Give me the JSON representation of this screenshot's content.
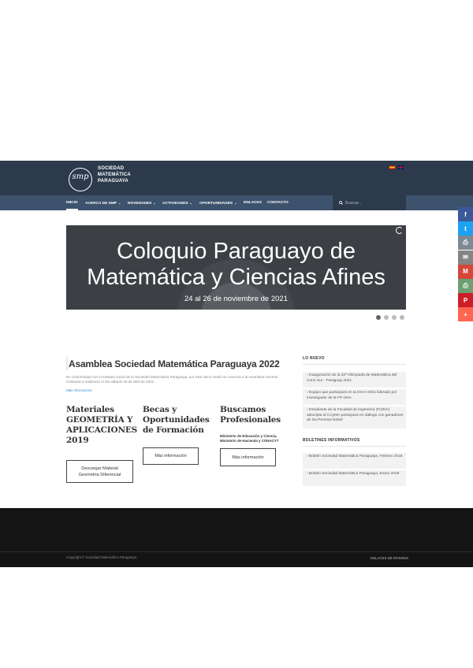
{
  "header": {
    "logo_glyph": "smp",
    "logo_lines": [
      "SOCIEDAD",
      "MATEMÁTICA",
      "PARAGUAYA"
    ]
  },
  "nav": {
    "items": [
      {
        "label": "INICIO"
      },
      {
        "label": "ACERCA DE SMP"
      },
      {
        "label": "NOVEDADES"
      },
      {
        "label": "ACTIVIDADES"
      },
      {
        "label": "OPORTUNIDADES"
      },
      {
        "label": "ENLACES"
      },
      {
        "label": "CONTACTO"
      }
    ],
    "search_placeholder": "Buscar..."
  },
  "slider": {
    "title_line1": "Coloquio Paraguayo de",
    "title_line2": "Matemática y Ciencias Afines",
    "subtitle": "24 al 26 de noviembre de 2021",
    "slide_count": 4,
    "active_slide": 1
  },
  "share": {
    "icons": [
      "facebook-icon",
      "twitter-icon",
      "print-icon",
      "email-icon",
      "gmail-icon",
      "printfriendly-icon",
      "pinterest-icon",
      "more-icon"
    ],
    "glyphs": [
      "f",
      "t",
      "⎙",
      "✉",
      "M",
      "⎙",
      "P",
      "+"
    ],
    "colors": [
      "#3b5998",
      "#1da1f2",
      "#7d8a94",
      "#848484",
      "#d44638",
      "#6d9f71",
      "#cb2027",
      "#ff6550"
    ]
  },
  "main": {
    "title": "Asamblea Sociedad Matemática Paraguaya 2022",
    "text": "En conformidad con el estatuto social de la Sociedad Matemática Paraguaya, por este único medio se convoca a la Asamblea General Ordinaria a realizarse el día sábado 30 de abril de 2022.",
    "more_link": "Más información",
    "columns": [
      {
        "title_lines": [
          "Materiales",
          "GEOMETRÍA Y",
          "APLICACIONES",
          "2019"
        ],
        "button_lines": [
          "Descargar Material",
          "Geometría Diferencial"
        ]
      },
      {
        "title_lines": [
          "Becas y",
          "Oportunidades",
          "de Formación"
        ],
        "button_lines": [
          "Más información"
        ]
      },
      {
        "title_lines": [
          "Buscamos",
          "Profesionales"
        ],
        "sub_lines": [
          "Ministerio de Educación y Ciencia,",
          "Ministerio de Hacienda y CONACYT"
        ],
        "button_lines": [
          "Más información"
        ]
      }
    ]
  },
  "sidebar": {
    "lo_nuevo": {
      "heading": "LO NUEVO",
      "items": [
        "› Inauguración de la 32ª Olimpiada de Matemática del Cono Sur - Paraguay 2021",
        "› Equipo que participará en la IOAA-2021 liderado por investigador de la FP-UNA",
        "› Estudiante de la Facultad de Ingeniería (FIUNA) adscripta al CCyMA participará en diálogo con ganadores de los Premios Nobel"
      ]
    },
    "boletines": {
      "heading": "BOLETINES INFORMATIVOS",
      "items": [
        "› Boletín Sociedad Matemática Paraguaya, Febrero 2018",
        "› Boletín Sociedad Matemática Paraguaya, Enero 2018"
      ]
    }
  },
  "footer": {
    "copyright": "Copyright © Sociedad Matemática Paraguaya",
    "link": "ENLACES DE INTERES"
  }
}
